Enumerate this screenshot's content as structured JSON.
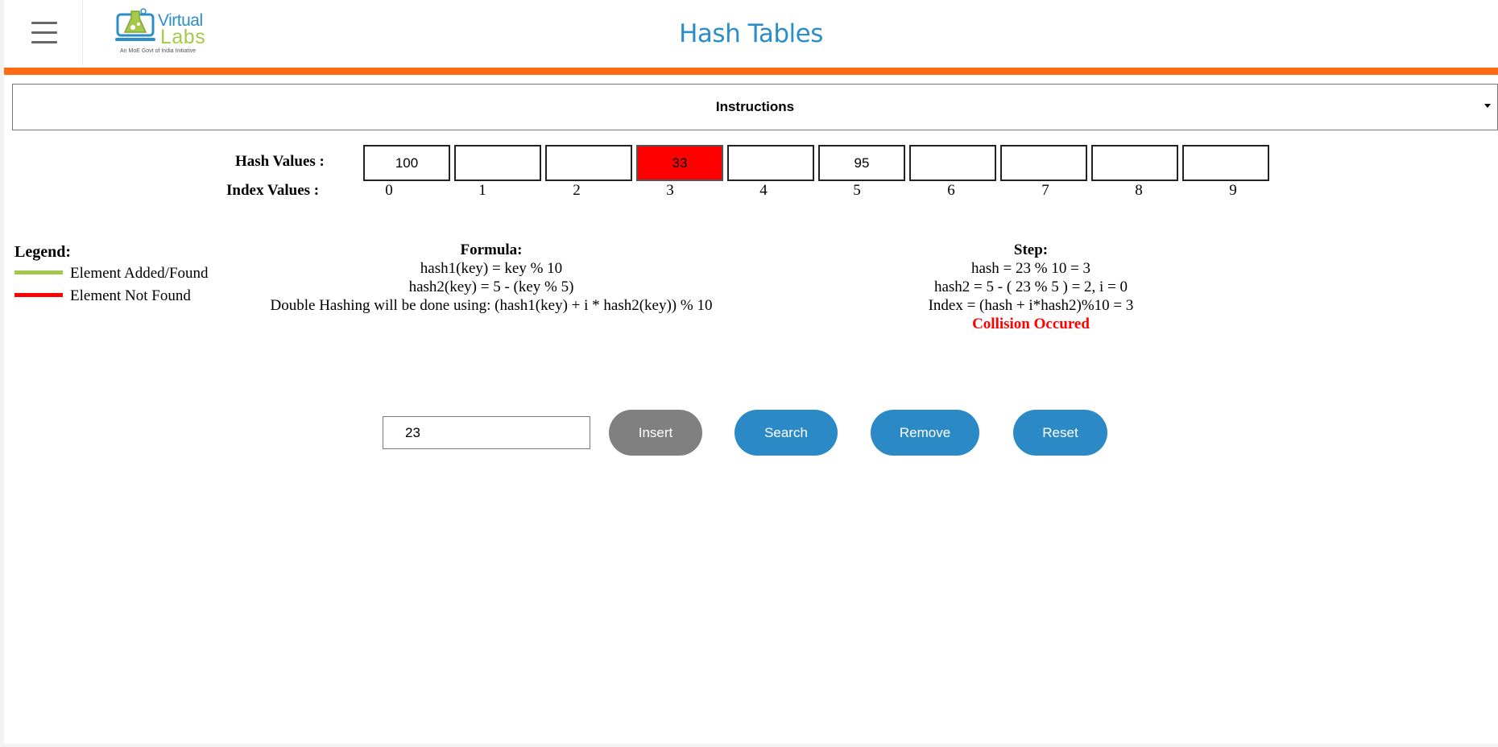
{
  "header": {
    "title": "Hash Tables",
    "logo_word1": "Virtual",
    "logo_word2": "Labs",
    "logo_tagline": "An MoE Govt of India Initiative"
  },
  "instructions": {
    "label": "Instructions"
  },
  "table": {
    "hash_label": "Hash Values :",
    "index_label": "Index Values :",
    "cells": [
      {
        "index": "0",
        "value": "100",
        "state": "normal"
      },
      {
        "index": "1",
        "value": "",
        "state": "normal"
      },
      {
        "index": "2",
        "value": "",
        "state": "normal"
      },
      {
        "index": "3",
        "value": "33",
        "state": "not-found"
      },
      {
        "index": "4",
        "value": "",
        "state": "normal"
      },
      {
        "index": "5",
        "value": "95",
        "state": "normal"
      },
      {
        "index": "6",
        "value": "",
        "state": "normal"
      },
      {
        "index": "7",
        "value": "",
        "state": "normal"
      },
      {
        "index": "8",
        "value": "",
        "state": "normal"
      },
      {
        "index": "9",
        "value": "",
        "state": "normal"
      }
    ]
  },
  "legend": {
    "title": "Legend:",
    "items": [
      {
        "label": "Element Added/Found",
        "color": "#a4c84e"
      },
      {
        "label": "Element Not Found",
        "color": "#ff0000"
      }
    ]
  },
  "formula": {
    "title": "Formula:",
    "lines": [
      "hash1(key) = key % 10",
      "hash2(key) = 5 - (key % 5)",
      "Double Hashing will be done using: (hash1(key) + i * hash2(key)) % 10"
    ]
  },
  "step": {
    "title": "Step:",
    "lines": [
      "hash = 23 % 10 = 3",
      "hash2 = 5 - ( 23 % 5 ) = 2, i = 0",
      "Index = (hash + i*hash2)%10 = 3"
    ],
    "alert": "Collision Occured"
  },
  "controls": {
    "input_value": "23",
    "insert_label": "Insert",
    "search_label": "Search",
    "remove_label": "Remove",
    "reset_label": "Reset"
  },
  "colors": {
    "brand_blue": "#2c8ec9",
    "accent_orange": "#ff6a13",
    "button_blue": "#2b8ac6",
    "button_disabled": "#808080",
    "not_found": "#ff0000",
    "found": "#a4c84e"
  }
}
